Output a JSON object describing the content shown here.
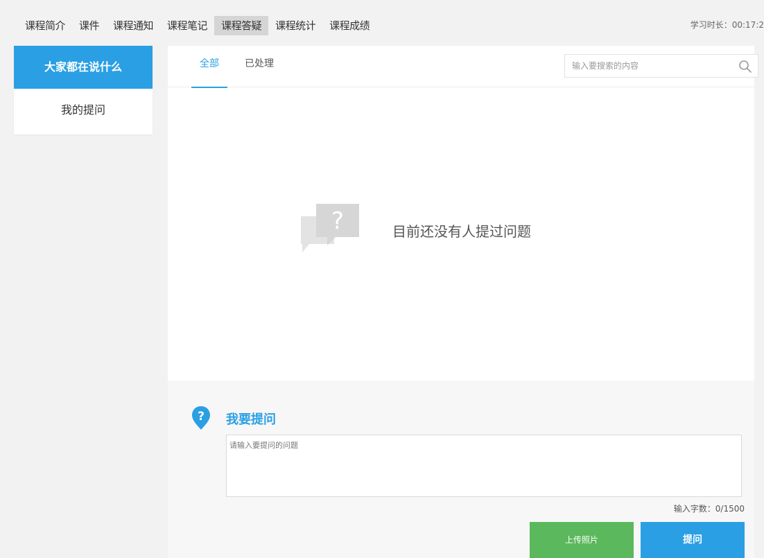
{
  "top_nav": {
    "tabs": [
      {
        "label": "课程简介",
        "active": false
      },
      {
        "label": "课件",
        "active": false
      },
      {
        "label": "课程通知",
        "active": false
      },
      {
        "label": "课程笔记",
        "active": false
      },
      {
        "label": "课程答疑",
        "active": true
      },
      {
        "label": "课程统计",
        "active": false
      },
      {
        "label": "课程成绩",
        "active": false
      }
    ],
    "study_time": "学习时长：00:17:2"
  },
  "left_menu": {
    "items": [
      {
        "label": "大家都在说什么",
        "active": true
      },
      {
        "label": "我的提问",
        "active": false
      }
    ]
  },
  "sub_tabs": {
    "all": "全部",
    "processed": "已处理"
  },
  "search": {
    "placeholder": "输入要搜索的内容",
    "value": "",
    "icon": "search-icon"
  },
  "empty_state": {
    "icon": "question-bubble-icon",
    "message": "目前还没有人提过问题"
  },
  "ask_form": {
    "icon": "question-pin-icon",
    "title": "我要提问",
    "placeholder": "请输入要提问的问题",
    "value": "",
    "counter": "输入字数：0/1500",
    "upload_label": "上传照片",
    "submit_label": "提问"
  },
  "colors": {
    "accent": "#2a9fe4",
    "upload_green": "#5cb85c",
    "active_tab_bg": "#d5d5d5"
  }
}
